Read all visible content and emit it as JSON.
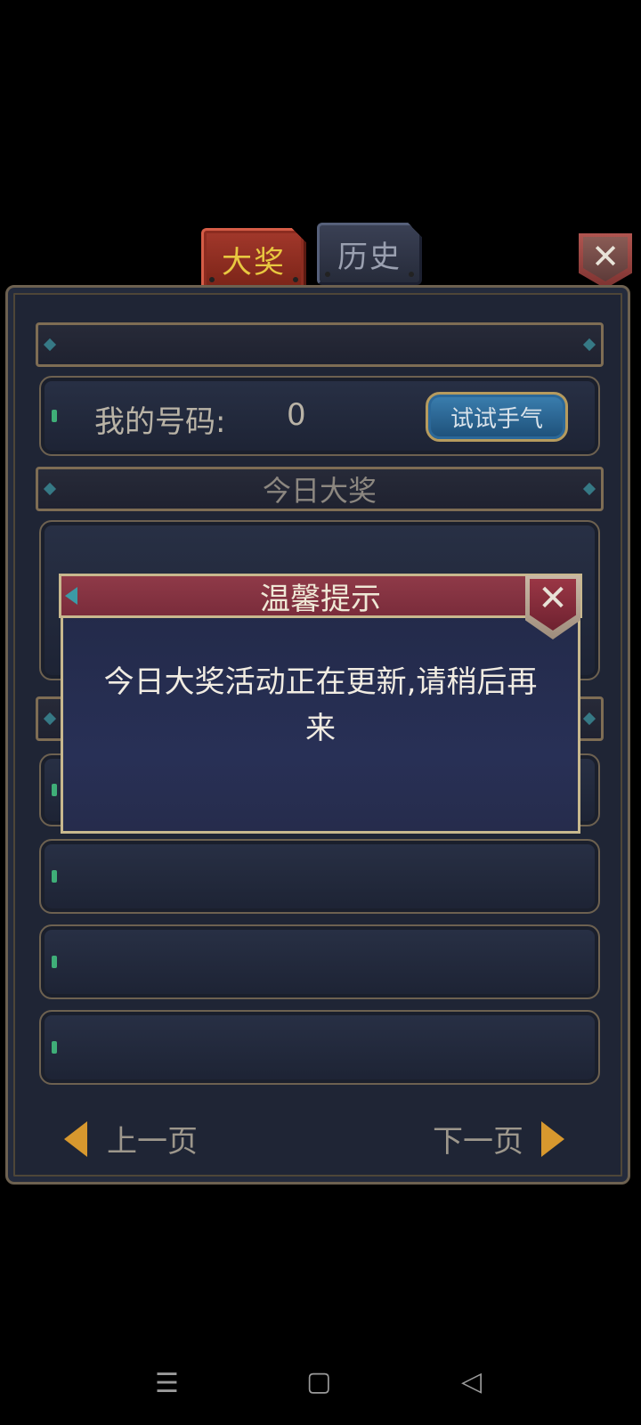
{
  "tabs": [
    {
      "label": "大奖",
      "active": true
    },
    {
      "label": "历史",
      "active": false
    }
  ],
  "header_close": {
    "symbol": "✕",
    "icon": "close-icon"
  },
  "my_number": {
    "label": "我的号码:",
    "value": "0"
  },
  "try_luck_button": "试试手气",
  "section_today": "今日大奖",
  "dialog": {
    "title": "温馨提示",
    "close_symbol": "✕",
    "message_line1": "今日大奖活动正在更新,请稍后再",
    "message_line2": "来"
  },
  "pager": {
    "prev": "上一页",
    "next": "下一页"
  },
  "nav_bar": {
    "menu_icon": "☰",
    "home_icon": "▢",
    "back_icon": "◁"
  },
  "colors": {
    "tab_active": "#8f3026",
    "tab_active_text": "#e8c840",
    "dialog_header": "#8f3a48",
    "button_blue": "#2b6899"
  }
}
